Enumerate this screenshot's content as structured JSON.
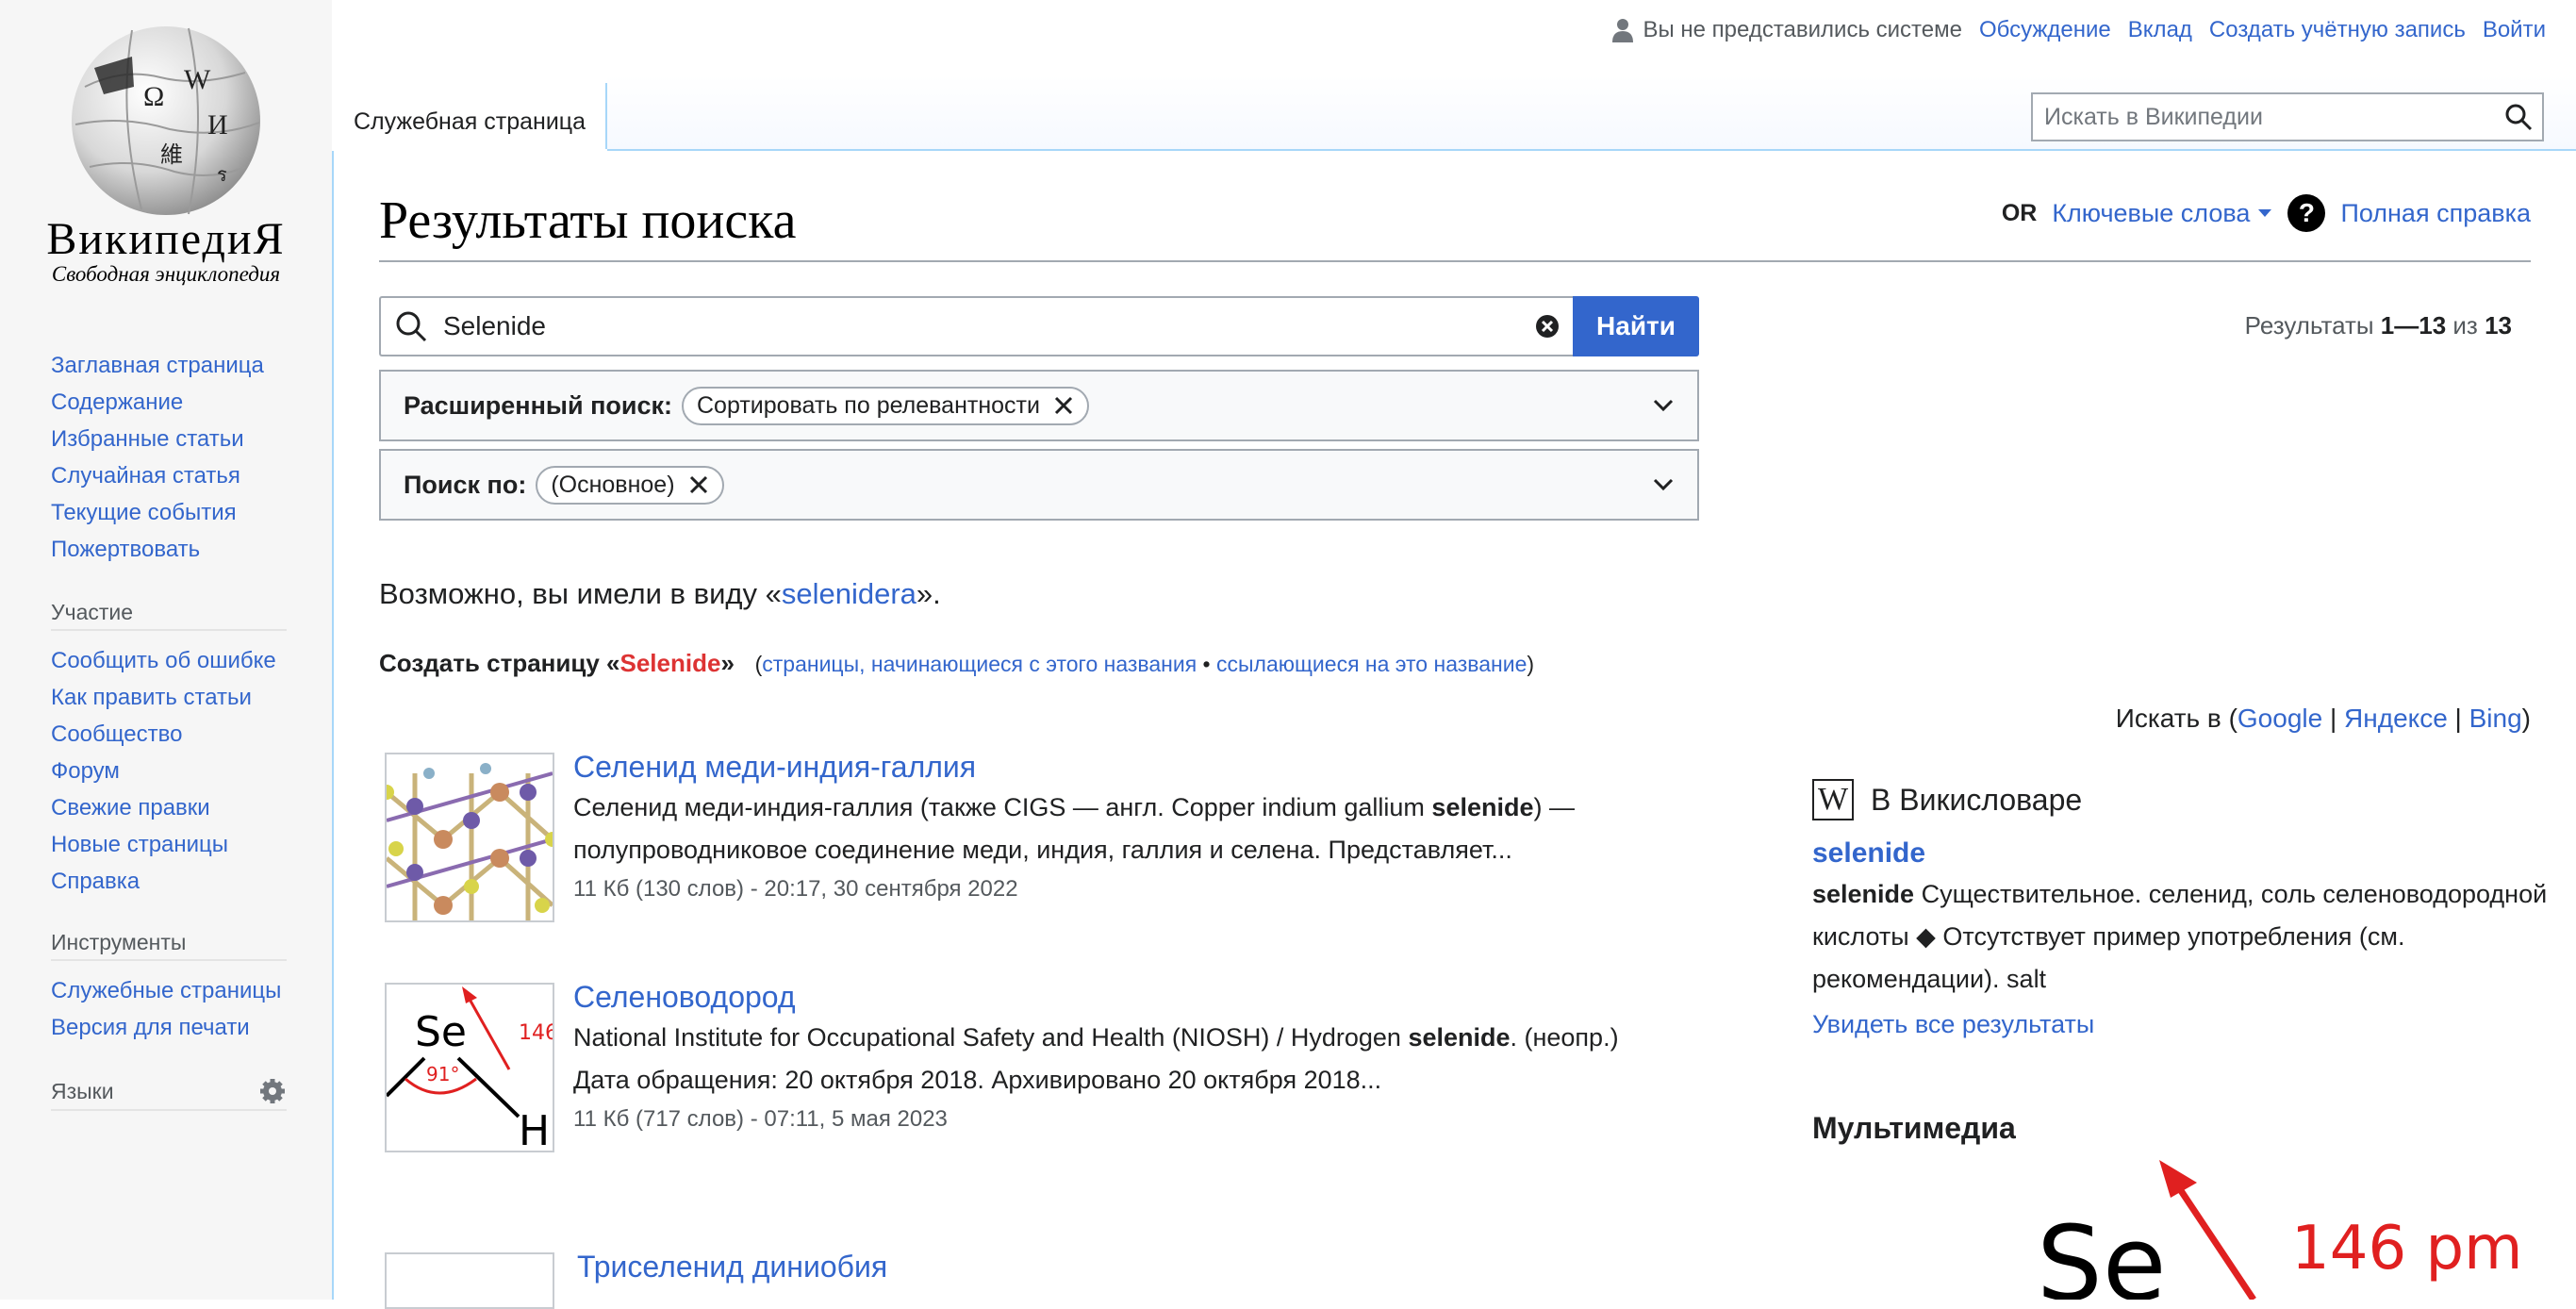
{
  "logo": {
    "wordmark": "ВикипедиЯ",
    "tagline": "Свободная энциклопедия"
  },
  "nav": {
    "main": [
      "Заглавная страница",
      "Содержание",
      "Избранные статьи",
      "Случайная статья",
      "Текущие события",
      "Пожертвовать"
    ],
    "participation": {
      "heading": "Участие",
      "items": [
        "Сообщить об ошибке",
        "Как править статьи",
        "Сообщество",
        "Форум",
        "Свежие правки",
        "Новые страницы",
        "Справка"
      ]
    },
    "tools": {
      "heading": "Инструменты",
      "items": [
        "Служебные страницы",
        "Версия для печати"
      ]
    },
    "languages": {
      "heading": "Языки"
    }
  },
  "personal": {
    "not_logged_in": "Вы не представились системе",
    "talk": "Обсуждение",
    "contributions": "Вклад",
    "create_account": "Создать учётную запись",
    "login": "Войти"
  },
  "tabs": {
    "special": "Служебная страница"
  },
  "header_search": {
    "placeholder": "Искать в Википедии"
  },
  "page": {
    "title": "Результаты поиска",
    "or_label": "OR",
    "keywords": "Ключевые слова",
    "help": "Полная справка",
    "help_icon": "?"
  },
  "search": {
    "query": "Selenide",
    "button": "Найти",
    "results_prefix": "Результаты ",
    "results_range": "1—13",
    "results_of": " из ",
    "results_total": "13"
  },
  "filters": {
    "advanced_label": "Расширенный поиск:",
    "advanced_chip": "Сортировать по релевантности",
    "namespace_label": "Поиск по:",
    "namespace_chip": "(Основное)"
  },
  "suggest": {
    "prefix": "Возможно, вы имели в виду «",
    "term": "selenidera",
    "suffix": "»."
  },
  "create": {
    "prefix": "Создать страницу «",
    "term": "Selenide",
    "suffix": "»",
    "open": "(",
    "starting": "страницы, начинающиеся с этого названия",
    "sep": " • ",
    "linking": "ссылающиеся на это название",
    "close": ")"
  },
  "elsewhere": {
    "prefix": "Искать в (",
    "google": "Google",
    "yandex": "Яндексе",
    "bing": "Bing",
    "sep": " | ",
    "close": ")"
  },
  "results": [
    {
      "title": "Селенид меди-индия-галлия",
      "snippet_a": "Селенид меди-индия-галлия (также CIGS — англ. Copper indium gallium ",
      "snippet_bold": "selenide",
      "snippet_b": ") — полупроводниковое соединение меди, индия, галлия и селена. Представляет...",
      "meta": "11 Кб (130 слов) - 20:17, 30 сентября 2022"
    },
    {
      "title": "Селеноводород",
      "snippet_a": "National Institute for Occupational Safety and Health (NIOSH) / Hydrogen ",
      "snippet_bold": "selenide",
      "snippet_b": ".  (неопр.) Дата обращения: 20 октября 2018. Архивировано 20 октября 2018...",
      "meta": "11 Кб (717 слов) - 07:11, 5 мая 2023",
      "thumb_se": "Se",
      "thumb_h": "H",
      "thumb_angle": "91°",
      "thumb_len": "146"
    },
    {
      "title": "Триселенид диниобия"
    }
  ],
  "sister": {
    "wiktionary_heading": "В Викисловаре",
    "wiktionary_icon": "W",
    "word": "selenide",
    "def_bold": "selenide",
    "def_rest": " Существительное. селенид, соль селеноводородной кислоты ◆ Отсутствует пример употребления (см. рекомендации). salt",
    "see_all": "Увидеть все результаты",
    "media_heading": "Мультимедиа",
    "media_se": "Se",
    "media_len": "146 pm"
  }
}
